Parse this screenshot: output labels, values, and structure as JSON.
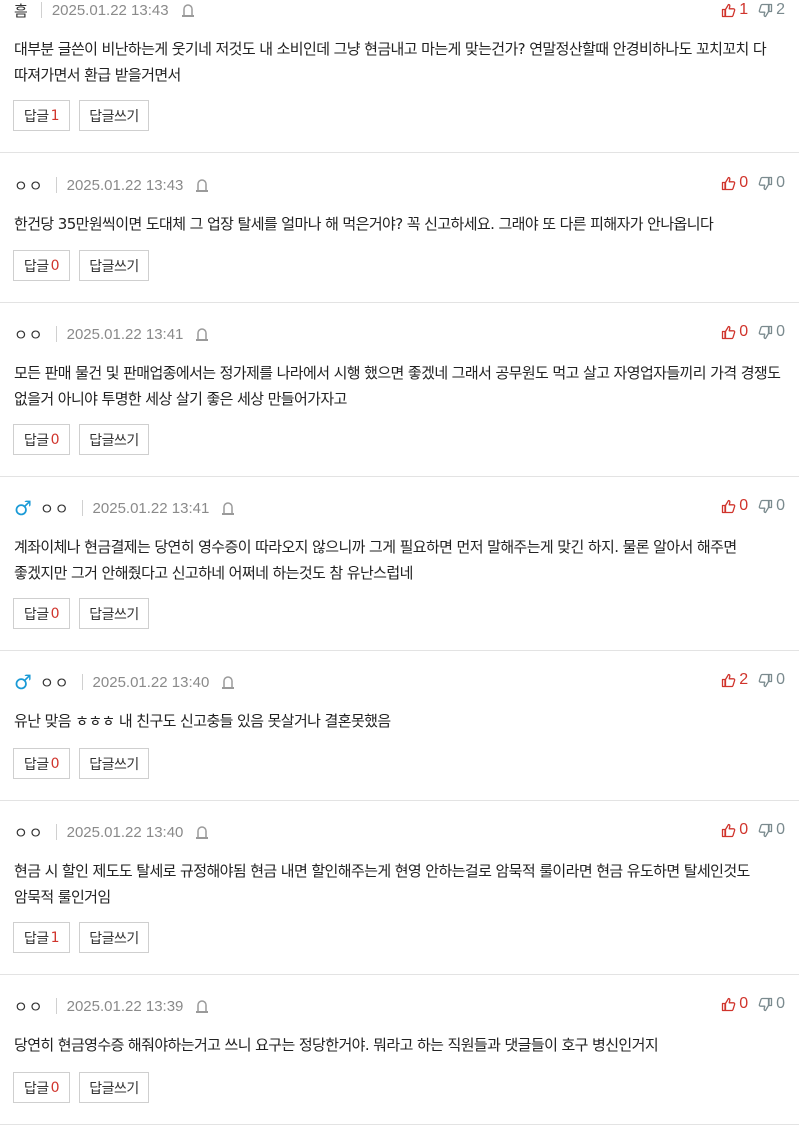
{
  "labels": {
    "reply": "답글",
    "write": "답글쓰기"
  },
  "icons": {
    "gender": "male-sign-icon",
    "report": "siren-icon",
    "like": "thumbs-up-icon",
    "dislike": "thumbs-down-icon"
  },
  "colors": {
    "like": "#d0342c",
    "dislike": "#7a8a8e",
    "gender": "#1a9ad6"
  },
  "comments": [
    {
      "nick": "흠",
      "gender": "",
      "date": "2025.01.22 13:43",
      "up": "1",
      "down": "2",
      "replies": "1",
      "text": "대부분 글쓴이 비난하는게 웃기네 저것도 내 소비인데 그냥 현금내고 마는게 맞는건가? 연말정산할때 안경비하나도 꼬치꼬치 다 따져가면서 환급 받을거면서"
    },
    {
      "nick": "ㅇㅇ",
      "gender": "",
      "date": "2025.01.22 13:43",
      "up": "0",
      "down": "0",
      "replies": "0",
      "text": "한건당 35만원씩이면 도대체 그 업장 탈세를 얼마나 해 먹은거야? 꼭 신고하세요. 그래야 또 다른 피해자가 안나옵니다"
    },
    {
      "nick": "ㅇㅇ",
      "gender": "",
      "date": "2025.01.22 13:41",
      "up": "0",
      "down": "0",
      "replies": "0",
      "text": "모든 판매 물건 및 판매업종에서는 정가제를 나라에서 시행 했으면 좋겠네 그래서 공무원도 먹고 살고 자영업자들끼리 가격 경쟁도 없을거 아니야 투명한 세상 살기 좋은 세상 만들어가자고"
    },
    {
      "nick": "ㅇㅇ",
      "gender": "♂",
      "date": "2025.01.22 13:41",
      "up": "0",
      "down": "0",
      "replies": "0",
      "text": "계좌이체나 현금결제는 당연히 영수증이 따라오지 않으니까 그게 필요하면 먼저 말해주는게 맞긴 하지. 물론 알아서 해주면 좋겠지만 그거 안해줬다고 신고하네 어쩌네 하는것도 참 유난스럽네"
    },
    {
      "nick": "ㅇㅇ",
      "gender": "♂",
      "date": "2025.01.22 13:40",
      "up": "2",
      "down": "0",
      "replies": "0",
      "text": "유난 맞음 ㅎㅎㅎ 내 친구도 신고충들 있음 못살거나 결혼못했음"
    },
    {
      "nick": "ㅇㅇ",
      "gender": "",
      "date": "2025.01.22 13:40",
      "up": "0",
      "down": "0",
      "replies": "1",
      "text": "현금 시 할인 제도도 탈세로 규정해야됨 현금 내면 할인해주는게 현영 안하는걸로 암묵적 룰이라면 현금 유도하면 탈세인것도 암묵적 룰인거임"
    },
    {
      "nick": "ㅇㅇ",
      "gender": "",
      "date": "2025.01.22 13:39",
      "up": "0",
      "down": "0",
      "replies": "0",
      "text": "당연히 현금영수증 해줘야하는거고 쓰니 요구는 정당한거야. 뭐라고 하는 직원들과 댓글들이 호구 병신인거지"
    }
  ]
}
